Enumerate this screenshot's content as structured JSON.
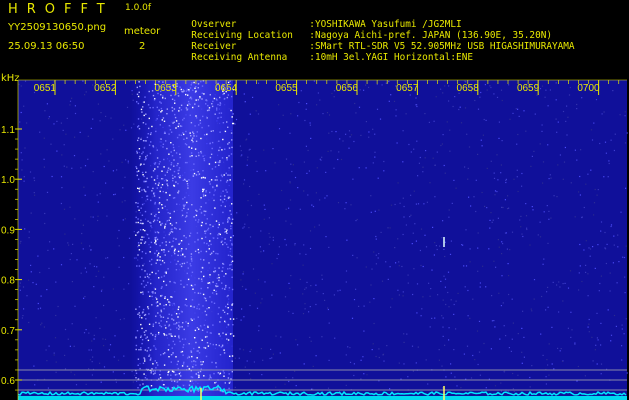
{
  "header": {
    "app_title": "HROFFT",
    "app_version": "1.0.0f",
    "file_name": "YY2509130650.png",
    "timestamp": "25.09.13 06:50",
    "meteor_label": "meteor",
    "meteor_count": "2"
  },
  "station_info": [
    {
      "key": "Ovserver",
      "value": ":YOSHIKAWA Yasufumi /JG2MLI"
    },
    {
      "key": "Receiving Location",
      "value": ":Nagoya Aichi-pref. JAPAN (136.90E, 35.20N)"
    },
    {
      "key": "Receiver",
      "value": ":SMart RTL-SDR V5 52.905MHz USB HIGASHIMURAYAMA"
    },
    {
      "key": "Receiving Antenna",
      "value": ":10mH 3el.YAGI Horizontal:ENE"
    }
  ],
  "axis": {
    "freq_unit": "kHz",
    "time_labels": [
      "0651",
      "0652",
      "0653",
      "0654",
      "0655",
      "0656",
      "0657",
      "0658",
      "0659",
      "0700"
    ],
    "freq_labels": [
      "1.1",
      "1.0",
      "0.9",
      "0.8",
      "0.7",
      "0.6"
    ]
  },
  "colors": {
    "text": "#e8e800",
    "background": "#000000",
    "noise_base": "#1a1ad0",
    "signal": "#ffffff",
    "carrier": "#00e8ff"
  }
}
